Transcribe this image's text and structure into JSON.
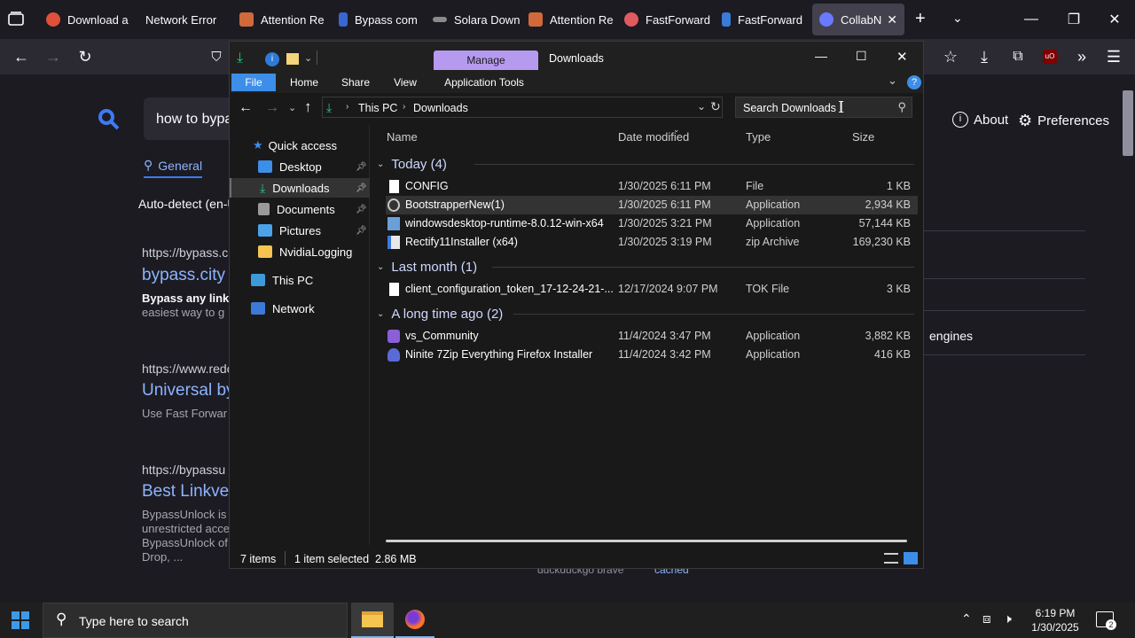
{
  "browser": {
    "tabs": [
      {
        "label": "Download a",
        "favicon_color": "#e0503a"
      },
      {
        "label": "Network Error",
        "favicon_color": ""
      },
      {
        "label": "Attention Re",
        "favicon_color": "#d06a3a"
      },
      {
        "label": "Bypass com",
        "favicon_color": "#3a66d0"
      },
      {
        "label": "Solara Down",
        "favicon_color": "#8a8a8a"
      },
      {
        "label": "Attention Re",
        "favicon_color": "#d06a3a"
      },
      {
        "label": "FastForward",
        "favicon_color": "#e05a60"
      },
      {
        "label": "FastForward",
        "favicon_color": "#3a7ad8"
      },
      {
        "label": "CollabNe",
        "favicon_color": "#6a7aff"
      }
    ]
  },
  "search_page": {
    "query": "how to bypa",
    "tab_general": "General",
    "region": "Auto-detect (en-U",
    "about": "About",
    "preferences": "Preferences",
    "engines_fragment": "engines",
    "footer_fragment": "duckduckgo  brave",
    "footer_cached": "cached",
    "results": [
      {
        "url": "https://bypass.c",
        "title": "bypass.city",
        "snippet_lines": [
          "Bypass any link",
          "easiest way to g"
        ]
      },
      {
        "url": "https://www.redo",
        "title": "Universal by",
        "snippet_lines": [
          "Use Fast Forwar"
        ]
      },
      {
        "url": "https://bypassu",
        "title": "Best Linkve",
        "snippet_lines": [
          "BypassUnlock is",
          "unrestricted acce",
          "BypassUnlock of",
          "Drop, ..."
        ]
      }
    ]
  },
  "explorer": {
    "title": "Downloads",
    "ribbon_context": "Manage",
    "ribbon_tabs": [
      "File",
      "Home",
      "Share",
      "View",
      "Application Tools"
    ],
    "breadcrumb": [
      "This PC",
      "Downloads"
    ],
    "search_placeholder": "Search Downloads",
    "nav": {
      "quick_access": "Quick access",
      "items": [
        "Desktop",
        "Downloads",
        "Documents",
        "Pictures",
        "NvidiaLogging"
      ],
      "this_pc": "This PC",
      "network": "Network"
    },
    "columns": {
      "name": "Name",
      "date": "Date modified",
      "type": "Type",
      "size": "Size"
    },
    "groups": [
      {
        "label": "Today (4)",
        "files": [
          {
            "name": "CONFIG",
            "date": "1/30/2025 6:11 PM",
            "type": "File",
            "size": "1 KB",
            "icon": "file-icon"
          },
          {
            "name": "BootstrapperNew(1)",
            "date": "1/30/2025 6:11 PM",
            "type": "Application",
            "size": "2,934 KB",
            "icon": "bootstrapper-icon",
            "selected": true
          },
          {
            "name": "windowsdesktop-runtime-8.0.12-win-x64",
            "date": "1/30/2025 3:21 PM",
            "type": "Application",
            "size": "57,144 KB",
            "icon": "installer-icon"
          },
          {
            "name": "Rectify11Installer (x64)",
            "date": "1/30/2025 3:19 PM",
            "type": "zip Archive",
            "size": "169,230 KB",
            "icon": "zip-icon"
          }
        ]
      },
      {
        "label": "Last month (1)",
        "files": [
          {
            "name": "client_configuration_token_17-12-24-21-...",
            "date": "12/17/2024 9:07 PM",
            "type": "TOK File",
            "size": "3 KB",
            "icon": "file-icon"
          }
        ]
      },
      {
        "label": "A long time ago (2)",
        "files": [
          {
            "name": "vs_Community",
            "date": "11/4/2024 3:47 PM",
            "type": "Application",
            "size": "3,882 KB",
            "icon": "visual-studio-icon"
          },
          {
            "name": "Ninite 7Zip Everything Firefox Installer",
            "date": "11/4/2024 3:42 PM",
            "type": "Application",
            "size": "416 KB",
            "icon": "ninite-icon"
          }
        ]
      }
    ],
    "status": {
      "count": "7 items",
      "selection": "1 item selected  2.86 MB"
    }
  },
  "taskbar": {
    "search_placeholder": "Type here to search",
    "time": "6:19 PM",
    "date": "1/30/2025",
    "notification_count": "2"
  }
}
